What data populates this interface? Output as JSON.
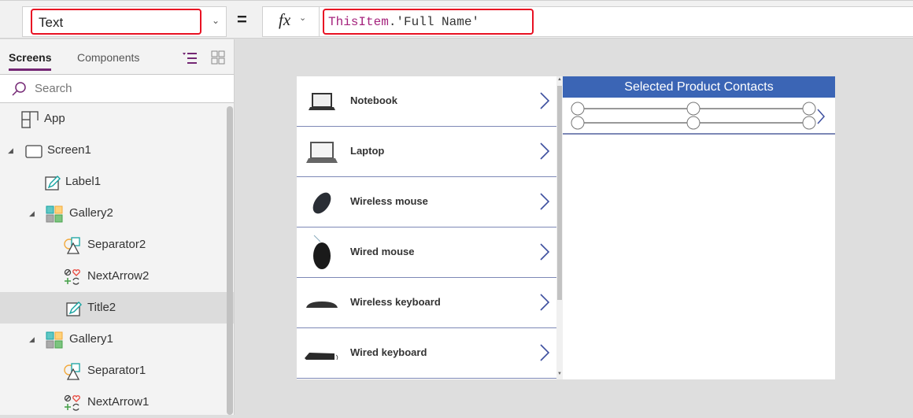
{
  "formula_bar": {
    "property": "Text",
    "equals": "=",
    "fx_label": "fx",
    "formula_keyword": "ThisItem",
    "formula_rest": ".'Full Name'"
  },
  "left_panel": {
    "tabs": [
      {
        "label": "Screens",
        "active": true
      },
      {
        "label": "Components",
        "active": false
      }
    ],
    "search": {
      "placeholder": "Search"
    },
    "tree": [
      {
        "label": "App",
        "icon": "app-icon",
        "indent": 0,
        "caret": false
      },
      {
        "label": "Screen1",
        "icon": "screen-icon",
        "indent": 0,
        "caret": true
      },
      {
        "label": "Label1",
        "icon": "label-icon",
        "indent": 1,
        "caret": false
      },
      {
        "label": "Gallery2",
        "icon": "gallery-icon",
        "indent": 1,
        "caret": true
      },
      {
        "label": "Separator2",
        "icon": "shapes-icon",
        "indent": 2,
        "caret": false
      },
      {
        "label": "NextArrow2",
        "icon": "icons-icon",
        "indent": 2,
        "caret": false
      },
      {
        "label": "Title2",
        "icon": "label-icon",
        "indent": 2,
        "caret": false,
        "selected": true
      },
      {
        "label": "Gallery1",
        "icon": "gallery-icon",
        "indent": 1,
        "caret": true
      },
      {
        "label": "Separator1",
        "icon": "shapes-icon",
        "indent": 2,
        "caret": false
      },
      {
        "label": "NextArrow1",
        "icon": "icons-icon",
        "indent": 2,
        "caret": false
      }
    ]
  },
  "gallery1": {
    "items": [
      {
        "title": "Notebook",
        "image": "notebook-image"
      },
      {
        "title": "Laptop",
        "image": "laptop-image"
      },
      {
        "title": "Wireless mouse",
        "image": "wireless-mouse-image"
      },
      {
        "title": "Wired mouse",
        "image": "wired-mouse-image"
      },
      {
        "title": "Wireless keyboard",
        "image": "wireless-keyboard-image"
      },
      {
        "title": "Wired keyboard",
        "image": "wired-keyboard-image"
      }
    ]
  },
  "gallery2": {
    "header": "Selected Product Contacts"
  },
  "colors": {
    "accent": "#742774",
    "header_blue": "#3b65b5",
    "highlight_red": "#e81123",
    "separator": "#7d88b6"
  }
}
